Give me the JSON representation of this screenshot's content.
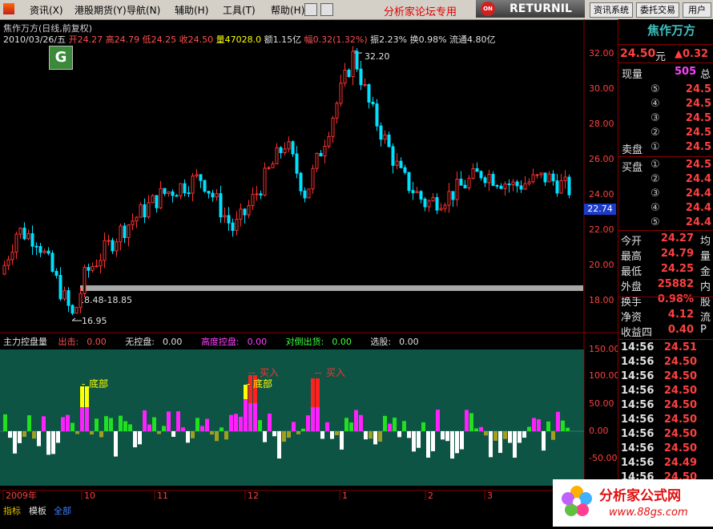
{
  "menu": {
    "items": [
      "资讯(X)",
      "港股期货(Y)",
      "导航(N)",
      "辅助(H)",
      "工具(T)",
      "帮助(H)"
    ],
    "forum_text": "分析家论坛专用",
    "returnil": "RETURNIL",
    "returnil_badge": "ON",
    "buttons": [
      "资讯系统",
      "委托交易",
      "用户"
    ]
  },
  "chart": {
    "title": "焦作万方(日线,前复权)",
    "date": "2010/03/26/五",
    "open_label": "开",
    "open": "24.27",
    "high_label": "高",
    "high": "24.79",
    "low_label": "低",
    "low": "24.25",
    "close_label": "收",
    "close": "24.50",
    "vol_label": "量",
    "vol": "47028.0",
    "amt_label": "额",
    "amt": "1.15亿",
    "chg_label": "幅",
    "chg": "0.32(1.32%)",
    "amp_label": "振",
    "amp": "2.23%",
    "turn_label": "换",
    "turn": "0.98%",
    "float_label": "流通",
    "float": "4.80亿",
    "max_label": "32.20",
    "min_label": "16.95",
    "range_label": "18.48-18.85",
    "price_tag": "22.74",
    "y_ticks": [
      "32.00",
      "30.00",
      "28.00",
      "26.00",
      "24.00",
      "22.00",
      "20.00",
      "18.00"
    ],
    "ann_bottom1": "底部",
    "ann_bottom2": "底部",
    "ann_buy1": "买入",
    "ann_buy2": "买入",
    "x_labels": [
      "2009年",
      "10",
      "11",
      "12",
      "1",
      "2",
      "3"
    ]
  },
  "indicator": {
    "name": "主力控盘量",
    "out_label": "出击:",
    "out_val": "0.00",
    "none_label": "无控盘:",
    "none_val": "0.00",
    "high_label": "高度控盘:",
    "high_val": "0.00",
    "dump_label": "对倒出货:",
    "dump_val": "0.00",
    "pick_label": "选股:",
    "pick_val": "0.00",
    "y_ticks": [
      "150.00",
      "100.00",
      "50.00",
      "0.00",
      "-50.00"
    ]
  },
  "panel": {
    "stock_name": "焦作万方",
    "price": "24.50",
    "price_unit": "元",
    "change": "▲0.32",
    "cur_vol_label": "现量",
    "cur_vol": "505",
    "cur_vol_tail": "总",
    "sell_rows": [
      {
        "n": "⑤",
        "v": "24.5"
      },
      {
        "n": "④",
        "v": "24.5"
      },
      {
        "n": "③",
        "v": "24.5"
      },
      {
        "n": "②",
        "v": "24.5"
      },
      {
        "n": "①",
        "v": "24.5"
      }
    ],
    "sell_label": "卖盘",
    "buy_label": "买盘",
    "buy_rows": [
      {
        "n": "①",
        "v": "24.5"
      },
      {
        "n": "②",
        "v": "24.4"
      },
      {
        "n": "③",
        "v": "24.4"
      },
      {
        "n": "④",
        "v": "24.4"
      },
      {
        "n": "⑤",
        "v": "24.4"
      }
    ],
    "stats": [
      {
        "l": "今开",
        "v": "24.27",
        "t": "均"
      },
      {
        "l": "最高",
        "v": "24.79",
        "t": "量"
      },
      {
        "l": "最低",
        "v": "24.25",
        "t": "金"
      },
      {
        "l": "外盘",
        "v": "25882",
        "t": "内"
      },
      {
        "l": "换手",
        "v": "0.98%",
        "t": "股"
      },
      {
        "l": "净资",
        "v": "4.12",
        "t": "流"
      },
      {
        "l": "收益四",
        "v": "0.40",
        "t": "P"
      }
    ],
    "ticks": [
      {
        "t": "14:56",
        "p": "24.51"
      },
      {
        "t": "14:56",
        "p": "24.50"
      },
      {
        "t": "14:56",
        "p": "24.50"
      },
      {
        "t": "14:56",
        "p": "24.50"
      },
      {
        "t": "14:56",
        "p": "24.50"
      },
      {
        "t": "14:56",
        "p": "24.50"
      },
      {
        "t": "14:56",
        "p": "24.50"
      },
      {
        "t": "14:56",
        "p": "24.50"
      },
      {
        "t": "14:56",
        "p": "24.49"
      },
      {
        "t": "14:56",
        "p": "24.50"
      },
      {
        "t": "14:56",
        "p": "24.50"
      }
    ]
  },
  "bottom": {
    "tabs": [
      "指标",
      "模板",
      "全部"
    ]
  },
  "logo": {
    "text": "分析家公式网",
    "url": "www.88gs.com"
  }
}
